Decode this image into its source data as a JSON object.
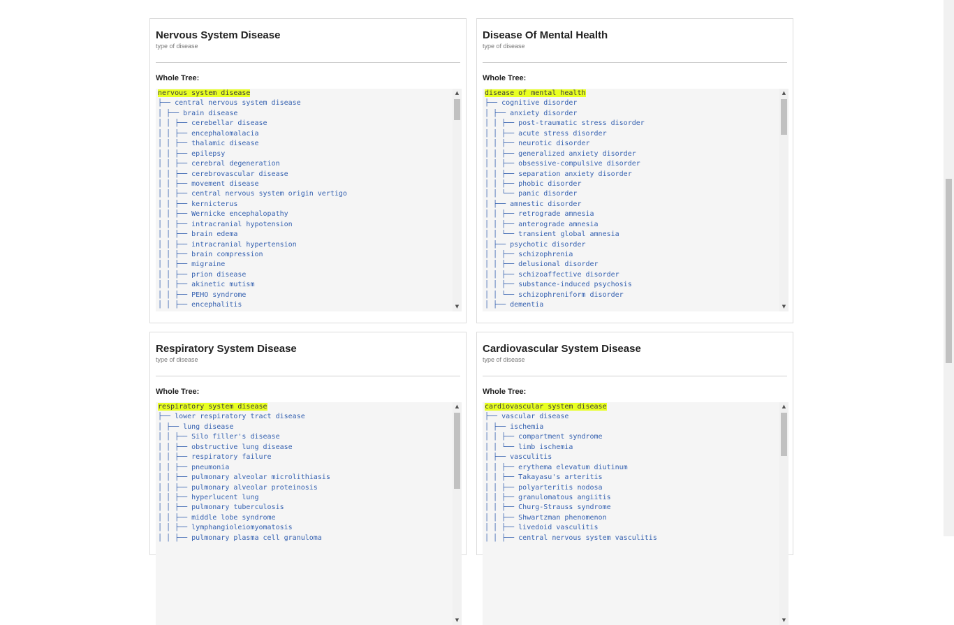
{
  "cards": [
    {
      "title": "Nervous System Disease",
      "subtitle": "type of disease",
      "tree_label": "Whole Tree:",
      "root": "nervous system disease",
      "lines": [
        "├── central nervous system disease",
        "│ ├── brain disease",
        "│ │ ├── cerebellar disease",
        "│ │ ├── encephalomalacia",
        "│ │ ├── thalamic disease",
        "│ │ ├── epilepsy",
        "│ │ ├── cerebral degeneration",
        "│ │ ├── cerebrovascular disease",
        "│ │ ├── movement disease",
        "│ │ ├── central nervous system origin vertigo",
        "│ │ ├── kernicterus",
        "│ │ ├── Wernicke encephalopathy",
        "│ │ ├── intracranial hypotension",
        "│ │ ├── brain edema",
        "│ │ ├── intracranial hypertension",
        "│ │ ├── brain compression",
        "│ │ ├── migraine",
        "│ │ ├── prion disease",
        "│ │ ├── akinetic mutism",
        "│ │ ├── PEHO syndrome",
        "│ │ ├── encephalitis"
      ],
      "scroll_thumb_fraction": 0.09
    },
    {
      "title": "Disease Of Mental Health",
      "subtitle": "type of disease",
      "tree_label": "Whole Tree:",
      "root": "disease of mental health",
      "lines": [
        "├── cognitive disorder",
        "│ ├── anxiety disorder",
        "│ │ ├── post-traumatic stress disorder",
        "│ │ ├── acute stress disorder",
        "│ │ ├── neurotic disorder",
        "│ │ ├── generalized anxiety disorder",
        "│ │ ├── obsessive-compulsive disorder",
        "│ │ ├── separation anxiety disorder",
        "│ │ ├── phobic disorder",
        "│ │ └── panic disorder",
        "│ ├── amnestic disorder",
        "│ │ ├── retrograde amnesia",
        "│ │ ├── anterograde amnesia",
        "│ │ └── transient global amnesia",
        "│ ├── psychotic disorder",
        "│ │ ├── schizophrenia",
        "│ │ ├── delusional disorder",
        "│ │ ├── schizoaffective disorder",
        "│ │ ├── substance-induced psychosis",
        "│ │ └── schizophreniform disorder",
        "│ ├── dementia"
      ],
      "scroll_thumb_fraction": 0.16
    },
    {
      "title": "Respiratory System Disease",
      "subtitle": "type of disease",
      "tree_label": "Whole Tree:",
      "root": "respiratory system disease",
      "lines": [
        "├── lower respiratory tract disease",
        "│ ├── lung disease",
        "│ │ ├── Silo filler's disease",
        "│ │ ├── obstructive lung disease",
        "│ │ ├── respiratory failure",
        "│ │ ├── pneumonia",
        "│ │ ├── pulmonary alveolar microlithiasis",
        "│ │ ├── pulmonary alveolar proteinosis",
        "│ │ ├── hyperlucent lung",
        "│ │ ├── pulmonary tuberculosis",
        "│ │ ├── middle lobe syndrome",
        "│ │ ├── lymphangioleiomyomatosis",
        "│ │ ├── pulmonary plasma cell granuloma"
      ],
      "scroll_thumb_fraction": 0.36
    },
    {
      "title": "Cardiovascular System Disease",
      "subtitle": "type of disease",
      "tree_label": "Whole Tree:",
      "root": "cardiovascular system disease",
      "lines": [
        "├── vascular disease",
        "│ ├── ischemia",
        "│ │ ├── compartment syndrome",
        "│ │ └── limb ischemia",
        "│ ├── vasculitis",
        "│ │ ├── erythema elevatum diutinum",
        "│ │ ├── Takayasu's arteritis",
        "│ │ ├── polyarteritis nodosa",
        "│ │ ├── granulomatous angiitis",
        "│ │ ├── Churg-Strauss syndrome",
        "│ │ ├── Shwartzman phenomenon",
        "│ │ ├── livedoid vasculitis",
        "│ │ ├── central nervous system vasculitis"
      ],
      "scroll_thumb_fraction": 0.2
    }
  ],
  "colors": {
    "highlight": "#e8ff21",
    "tree_text": "#3561b0",
    "tree_bg": "#f5f5f5"
  }
}
